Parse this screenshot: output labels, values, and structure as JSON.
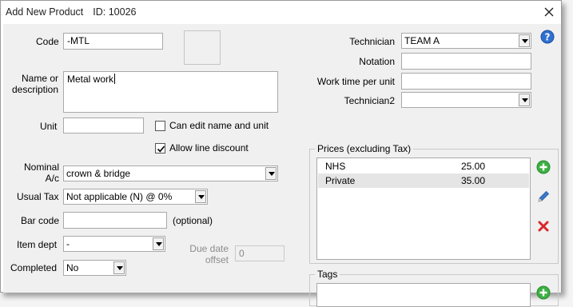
{
  "window": {
    "title": "Add New Product",
    "id_label": "ID: 10026"
  },
  "form": {
    "code": {
      "label": "Code",
      "value": "-MTL"
    },
    "name": {
      "label_line1": "Name or",
      "label_line2": "description",
      "value": "Metal work"
    },
    "unit": {
      "label": "Unit",
      "value": ""
    },
    "can_edit": {
      "label": "Can edit name and unit",
      "checked": false
    },
    "allow_discount": {
      "label": "Allow line discount",
      "checked": true
    },
    "nominal": {
      "label_line1": "Nominal",
      "label_line2": "A/c",
      "value": "crown & bridge"
    },
    "usual_tax": {
      "label": "Usual Tax",
      "value": "Not applicable (N) @ 0%"
    },
    "bar_code": {
      "label": "Bar code",
      "value": "",
      "hint": "(optional)"
    },
    "item_dept": {
      "label": "Item dept",
      "value": "-"
    },
    "due_date": {
      "label_line1": "Due date",
      "label_line2": "offset",
      "value": "0"
    },
    "completed": {
      "label": "Completed",
      "value": "No"
    },
    "technician": {
      "label": "Technician",
      "value": "TEAM A"
    },
    "notation": {
      "label": "Notation",
      "value": ""
    },
    "work_time": {
      "label": "Work time per unit",
      "value": ""
    },
    "technician2": {
      "label": "Technician2",
      "value": ""
    }
  },
  "prices": {
    "legend": "Prices (excluding Tax)",
    "rows": [
      {
        "name": "NHS",
        "price": "25.00"
      },
      {
        "name": "Private",
        "price": "35.00"
      }
    ]
  },
  "tags": {
    "legend": "Tags"
  },
  "colors": {
    "add": "#3cb043",
    "edit": "#3a78c9",
    "delete": "#d9262b",
    "help": "#2f6fd0"
  }
}
